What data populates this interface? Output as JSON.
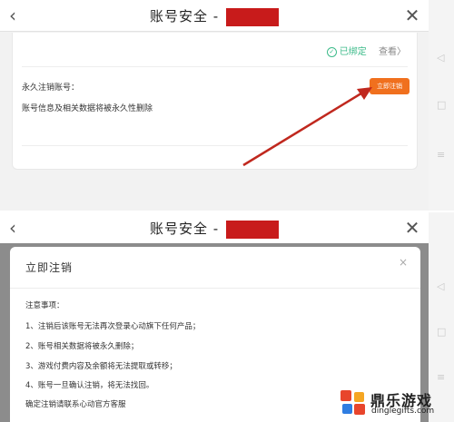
{
  "top": {
    "nav": {
      "back_icon": "‹",
      "title": "账号安全 -",
      "close_icon": "✕"
    },
    "bind": {
      "status": "已绑定",
      "view": "查看〉"
    },
    "permanent": {
      "title": "永久注销账号：",
      "description": "账号信息及相关数据将被永久性删除",
      "button": "立即注销"
    }
  },
  "bottom": {
    "nav": {
      "back_icon": "‹",
      "title": "账号安全 -",
      "close_icon": "✕"
    },
    "modal": {
      "title": "立即注销",
      "close": "×",
      "lines": [
        "注意事项：",
        "1、注销后该账号无法再次登录心动旗下任何产品；",
        "2、账号相关数据将被永久删除；",
        "3、游戏付费内容及余额将无法提取或转移；",
        "4、账号一旦确认注销，将无法找回。",
        "确定注销请联系心动官方客服"
      ]
    }
  },
  "logo": {
    "name": "鼎乐游戏",
    "domain": "dinglegifts.com"
  },
  "colors": {
    "accent": "#f0701e",
    "redact": "#c81b1b",
    "arrow": "#c0281e",
    "bound": "#3dbb8a"
  }
}
